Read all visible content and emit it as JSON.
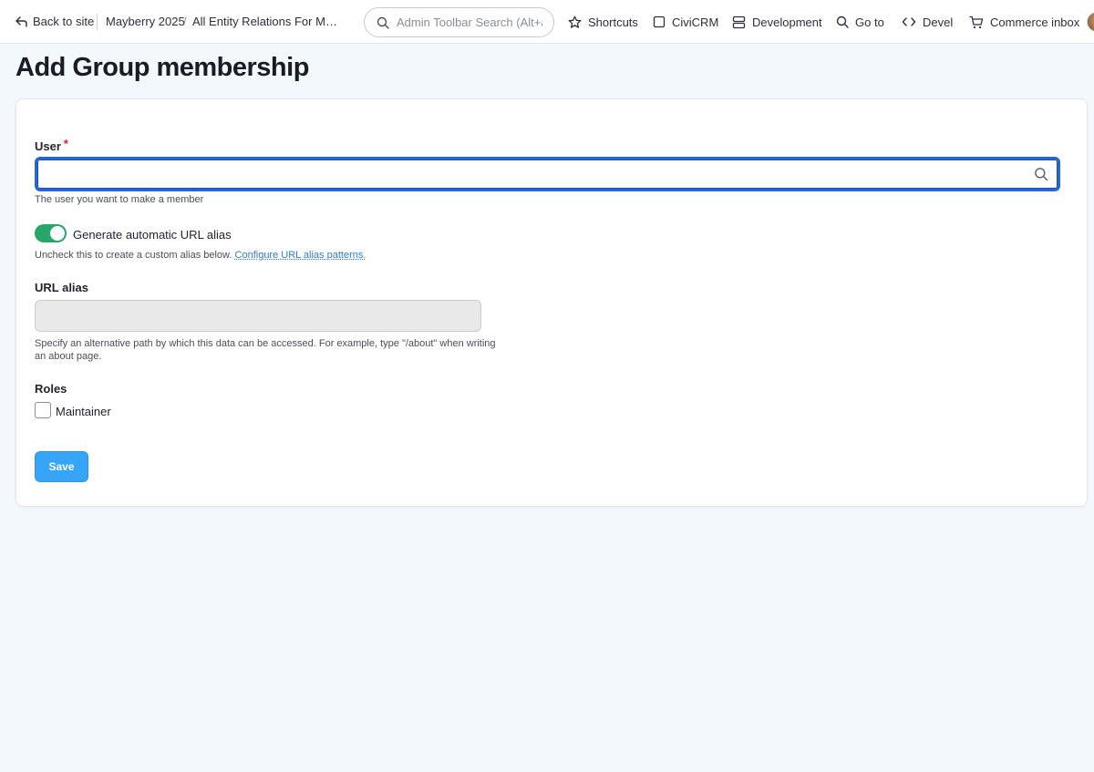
{
  "toolbar": {
    "back_label": "Back to site",
    "breadcrumb": [
      "Mayberry 2025",
      "All Entity Relations For Mayb..."
    ],
    "breadcrumb_separator": "/",
    "search_placeholder": "Admin Toolbar Search (Alt+a)",
    "items": [
      {
        "label": "Shortcuts",
        "icon": "star-icon"
      },
      {
        "label": "CiviCRM",
        "icon": "square-icon"
      },
      {
        "label": "Development",
        "icon": "server-icon"
      },
      {
        "label": "Go to",
        "icon": "search-icon"
      },
      {
        "label": "Devel",
        "icon": "code-icon"
      },
      {
        "label": "Commerce inbox",
        "icon": "cart-icon"
      }
    ]
  },
  "page": {
    "title": "Add Group membership"
  },
  "form": {
    "user": {
      "label": "User",
      "required_marker": "*",
      "value": "",
      "description": "The user you want to make a member"
    },
    "url_alias_toggle": {
      "label": "Generate automatic URL alias",
      "checked": true,
      "description_prefix": "Uncheck this to create a custom alias below.",
      "link_label": "Configure URL alias patterns."
    },
    "url_alias": {
      "label": "URL alias",
      "value": "",
      "description_line1": "Specify an alternative path by which this data can be accessed. For example, type \"/about\" when writing",
      "description_line2": "an about page."
    },
    "roles": {
      "label": "Roles",
      "options": [
        {
          "label": "Maintainer",
          "checked": false
        }
      ]
    },
    "save_label": "Save"
  },
  "colors": {
    "accent_blue": "#36a5f8",
    "focus_blue": "#2466d8",
    "toggle_green": "#26a769",
    "required_red": "#d72222",
    "link_blue": "#2d7be0"
  }
}
